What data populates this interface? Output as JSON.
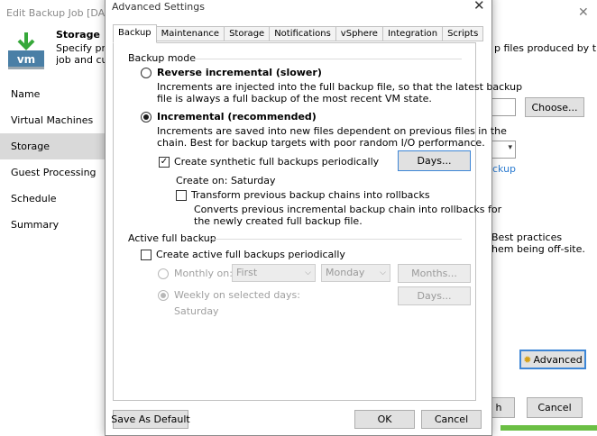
{
  "background_window": {
    "title": "Edit Backup Job [DAILY_",
    "header_title": "Storage",
    "header_desc_line1": "Specify pro",
    "header_desc_line2": "job and cus",
    "icon_label": "vm",
    "nav_items": [
      "Name",
      "Virtual Machines",
      "Storage",
      "Guest Processing",
      "Schedule",
      "Summary"
    ],
    "active_nav": "Storage",
    "right_text": "p files produced by this",
    "choose_label": "Choose...",
    "link_text": "ckup",
    "best_practices_line1": "Best practices",
    "best_practices_line2": "hem being off-site.",
    "advanced_label": "Advanced",
    "finish_label": "h",
    "cancel_label": "Cancel",
    "colors": {
      "active_nav_bg": "#d9d9d9",
      "link": "#2b7bd0",
      "accent_border": "#3d86d6",
      "green": "#6bbf44"
    }
  },
  "dialog": {
    "title": "Advanced Settings",
    "close_glyph": "✕",
    "tabs": [
      "Backup",
      "Maintenance",
      "Storage",
      "Notifications",
      "vSphere",
      "Integration",
      "Scripts"
    ],
    "active_tab": "Backup",
    "backup_mode": {
      "label": "Backup mode",
      "reverse": {
        "label": "Reverse incremental (slower)",
        "desc_line1": "Increments are injected into the full backup file, so that the latest backup",
        "desc_line2": "file is always a full backup of the most recent VM state.",
        "selected": false
      },
      "incremental": {
        "label": "Incremental (recommended)",
        "desc_line1": "Increments are saved into new files dependent on previous files in the",
        "desc_line2": "chain. Best for backup targets with poor random I/O performance.",
        "selected": true
      },
      "synthetic": {
        "label": "Create synthetic full backups periodically",
        "checked": true,
        "days_button": "Days...",
        "create_on": "Create on:  Saturday"
      },
      "transform": {
        "label": "Transform previous backup chains into rollbacks",
        "checked": false,
        "desc_line1": "Converts previous incremental backup chain into rollbacks for",
        "desc_line2": "the newly created full backup file."
      }
    },
    "active_full": {
      "label": "Active full backup",
      "create_label": "Create active full backups periodically",
      "checked": false,
      "monthly_label": "Monthly on:",
      "monthly_week": "First",
      "monthly_day": "Monday",
      "months_button": "Months...",
      "weekly_label": "Weekly on selected days:",
      "weekly_days": "Saturday",
      "days_button": "Days..."
    },
    "buttons": {
      "save_default": "Save As Default",
      "ok": "OK",
      "cancel": "Cancel"
    }
  }
}
